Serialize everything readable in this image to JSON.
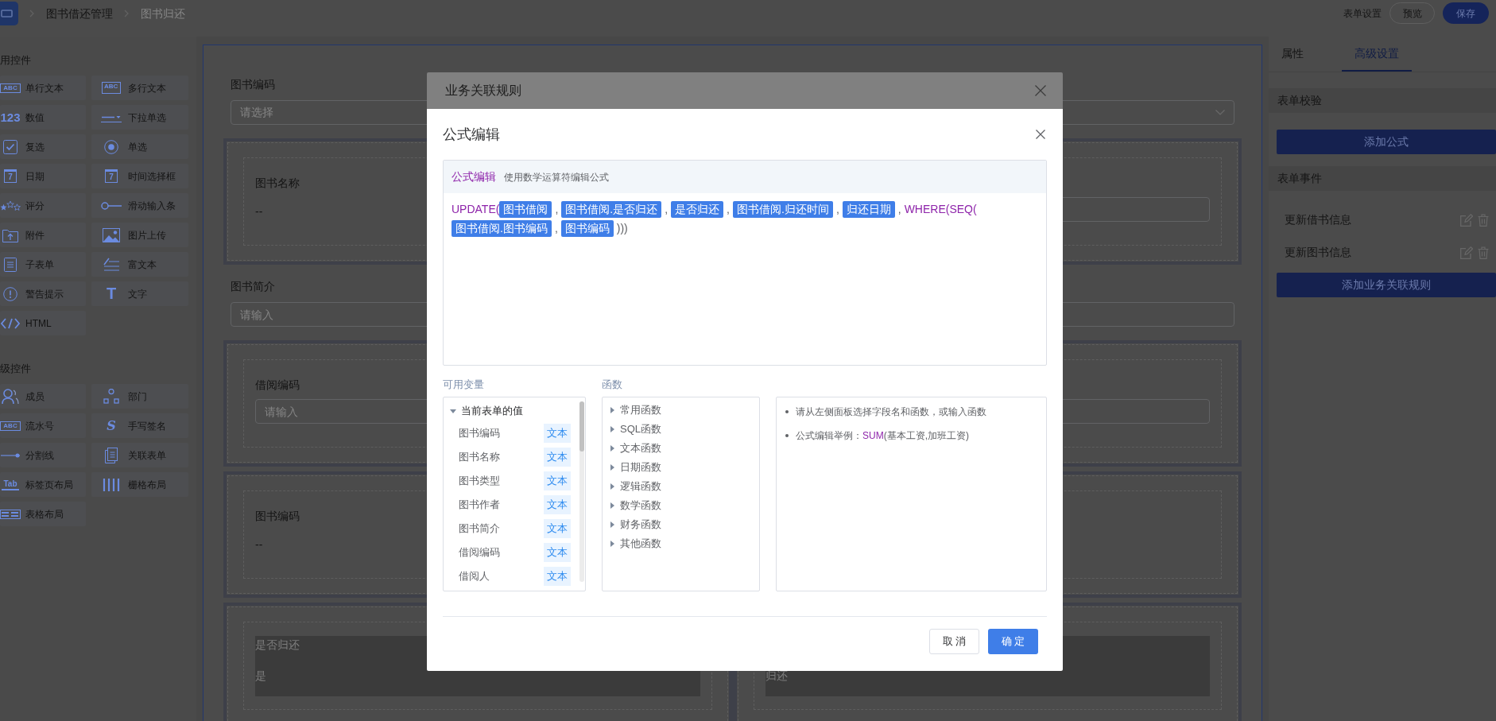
{
  "topbar": {
    "breadcrumb": [
      {
        "label": "图书借还管理",
        "current": false
      },
      {
        "label": "图书归还",
        "current": true
      }
    ],
    "actions": [
      {
        "kind": "link",
        "label": "表单设置"
      },
      {
        "kind": "outline",
        "label": "预览"
      },
      {
        "kind": "primary",
        "label": "保存"
      }
    ]
  },
  "sidebar": {
    "sections": [
      {
        "title": "用控件",
        "items": [
          {
            "kind": "text",
            "label": "单行文本",
            "icon_text": "ABC"
          },
          {
            "kind": "textarea",
            "label": "多行文本",
            "icon_text": "ABC"
          },
          {
            "kind": "number",
            "label": "数值",
            "icon_text": "123"
          },
          {
            "kind": "select",
            "label": "下拉单选"
          },
          {
            "kind": "checkbox",
            "label": "复选"
          },
          {
            "kind": "radio",
            "label": "单选"
          },
          {
            "kind": "date",
            "label": "日期",
            "icon_text": "7"
          },
          {
            "kind": "time",
            "label": "时间选择框",
            "icon_text": "7"
          },
          {
            "kind": "rate",
            "label": "评分"
          },
          {
            "kind": "slider",
            "label": "滑动输入条"
          },
          {
            "kind": "file",
            "label": "附件"
          },
          {
            "kind": "image",
            "label": "图片上传"
          },
          {
            "kind": "subform",
            "label": "子表单"
          },
          {
            "kind": "richtext",
            "label": "富文本"
          },
          {
            "kind": "alert",
            "label": "警告提示"
          },
          {
            "kind": "label",
            "label": "文字",
            "icon_text": "T"
          },
          {
            "kind": "html",
            "label": "HTML"
          }
        ]
      },
      {
        "title": "级控件",
        "items": [
          {
            "kind": "member",
            "label": "成员"
          },
          {
            "kind": "department",
            "label": "部门"
          },
          {
            "kind": "serial",
            "label": "流水号",
            "icon_text": "ABC"
          },
          {
            "kind": "signature",
            "label": "手写签名",
            "icon_text": "S"
          },
          {
            "kind": "divider",
            "label": "分割线"
          },
          {
            "kind": "relation",
            "label": "关联表单"
          },
          {
            "kind": "tabs",
            "label": "标签页布局",
            "icon_text": "Tab"
          },
          {
            "kind": "grid",
            "label": "栅格布局"
          },
          {
            "kind": "table",
            "label": "表格布局"
          }
        ]
      }
    ]
  },
  "form": {
    "rows": [
      {
        "kind": "select",
        "label": "图书编码",
        "placeholder": "请选择"
      },
      {
        "kind": "group",
        "cells": [
          {
            "kind": "text",
            "label": "图书名称",
            "value": "--",
            "disabled": false
          },
          {
            "kind": "input",
            "disabled": false
          }
        ]
      },
      {
        "kind": "input",
        "label": "图书简介",
        "placeholder": "请输入"
      },
      {
        "kind": "group",
        "cells": [
          {
            "kind": "input",
            "label": "借阅编码",
            "placeholder": "请输入",
            "disabled": false
          },
          {
            "kind": "input",
            "disabled": false
          }
        ]
      },
      {
        "kind": "group",
        "cells": [
          {
            "kind": "text",
            "label": "图书编码",
            "value": "--",
            "disabled": false
          },
          {
            "kind": "blank",
            "disabled": false
          }
        ]
      },
      {
        "kind": "group",
        "cells": [
          {
            "kind": "text",
            "label": "是否归还",
            "value": "是",
            "disabled": true
          },
          {
            "kind": "text",
            "value": "归还",
            "disabled": true
          }
        ]
      }
    ]
  },
  "right_panel": {
    "tabs": [
      {
        "label": "属性",
        "selected": false
      },
      {
        "label": "高级设置",
        "selected": true
      }
    ],
    "sections": [
      {
        "title": "表单校验",
        "button": "添加公式"
      },
      {
        "title": "表单事件",
        "items": [
          {
            "label": "更新借书信息"
          },
          {
            "label": "更新图书信息"
          }
        ],
        "button": "添加业务关联规则"
      }
    ]
  },
  "rule_dialog": {
    "title": "业务关联规则"
  },
  "formula_dialog": {
    "title": "公式编辑",
    "editor": {
      "label": "公式编辑",
      "hint": "使用数学运算符编辑公式",
      "tokens": [
        {
          "kind": "func",
          "text": "UPDATE("
        },
        {
          "kind": "field",
          "text": "图书借阅"
        },
        {
          "kind": "sep",
          "text": ","
        },
        {
          "kind": "field",
          "text": "图书借阅.是否归还"
        },
        {
          "kind": "sep",
          "text": ","
        },
        {
          "kind": "field",
          "text": "是否归还"
        },
        {
          "kind": "sep",
          "text": ","
        },
        {
          "kind": "field",
          "text": "图书借阅.归还时间"
        },
        {
          "kind": "sep",
          "text": ","
        },
        {
          "kind": "field",
          "text": "归还日期"
        },
        {
          "kind": "sep",
          "text": ","
        },
        {
          "kind": "func",
          "text": "WHERE(SEQ("
        },
        {
          "kind": "field",
          "text": "图书借阅.图书编码"
        },
        {
          "kind": "sep",
          "text": ","
        },
        {
          "kind": "field",
          "text": "图书编码"
        },
        {
          "kind": "sep",
          "text": ")))"
        }
      ]
    },
    "variables": {
      "label": "可用变量",
      "tree": [
        {
          "label": "当前表单的值",
          "expanded": true,
          "children": [
            {
              "label": "图书编码",
              "type": "文本"
            },
            {
              "label": "图书名称",
              "type": "文本"
            },
            {
              "label": "图书类型",
              "type": "文本"
            },
            {
              "label": "图书作者",
              "type": "文本"
            },
            {
              "label": "图书简介",
              "type": "文本"
            },
            {
              "label": "借阅编码",
              "type": "文本"
            },
            {
              "label": "借阅人",
              "type": "文本"
            }
          ]
        }
      ]
    },
    "functions": {
      "label": "函数",
      "items": [
        {
          "label": "常用函数",
          "expanded": false
        },
        {
          "label": "SQL函数",
          "expanded": false
        },
        {
          "label": "文本函数",
          "expanded": false
        },
        {
          "label": "日期函数",
          "expanded": false
        },
        {
          "label": "逻辑函数",
          "expanded": false
        },
        {
          "label": "数学函数",
          "expanded": false
        },
        {
          "label": "财务函数",
          "expanded": false
        },
        {
          "label": "其他函数",
          "expanded": false
        }
      ]
    },
    "help": [
      {
        "segments": [
          {
            "kind": "plain",
            "text": "请从左侧面板选择字段名和函数，或输入函数"
          }
        ]
      },
      {
        "segments": [
          {
            "kind": "plain",
            "text": "公式编辑举例："
          },
          {
            "kind": "func",
            "text": "SUM"
          },
          {
            "kind": "plain",
            "text": "(基本工资,加班工资)"
          }
        ]
      }
    ],
    "buttons": [
      {
        "kind": "default",
        "label": "取 消"
      },
      {
        "kind": "primary",
        "label": "确 定"
      }
    ]
  }
}
